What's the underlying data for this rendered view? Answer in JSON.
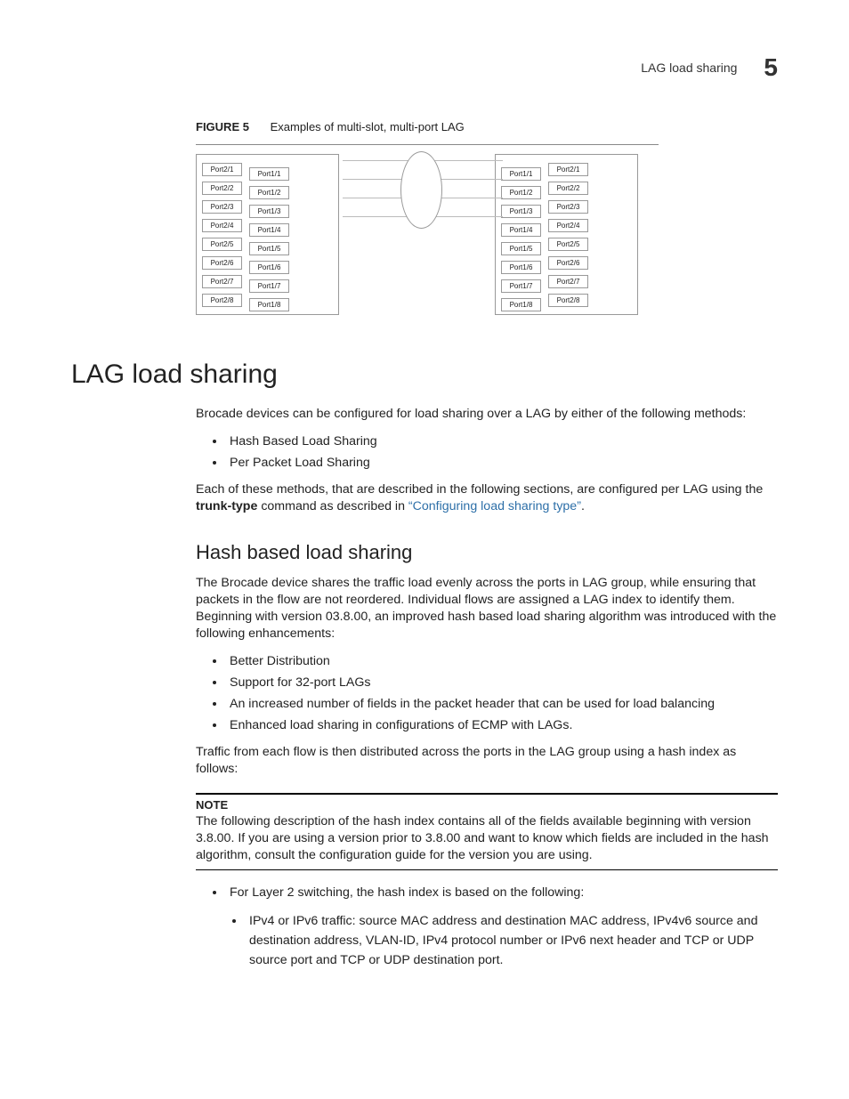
{
  "header": {
    "running_title": "LAG load sharing",
    "chapter_number": "5"
  },
  "figure": {
    "label": "FIGURE 5",
    "caption": "Examples of multi-slot, multi-port LAG",
    "left_switch_rows": [
      [
        "Port2/1",
        "Port1/1"
      ],
      [
        "Port2/2",
        "Port1/2"
      ],
      [
        "Port2/3",
        "Port1/3"
      ],
      [
        "Port2/4",
        "Port1/4"
      ],
      [
        "Port2/5",
        "Port1/5"
      ],
      [
        "Port2/6",
        "Port1/6"
      ],
      [
        "Port2/7",
        "Port1/7"
      ],
      [
        "Port2/8",
        "Port1/8"
      ]
    ],
    "right_switch_rows": [
      [
        "Port1/1",
        "Port2/1"
      ],
      [
        "Port1/2",
        "Port2/2"
      ],
      [
        "Port1/3",
        "Port2/3"
      ],
      [
        "Port1/4",
        "Port2/4"
      ],
      [
        "Port1/5",
        "Port2/5"
      ],
      [
        "Port1/6",
        "Port2/6"
      ],
      [
        "Port1/7",
        "Port2/7"
      ],
      [
        "Port1/8",
        "Port2/8"
      ]
    ]
  },
  "section": {
    "title": "LAG load sharing",
    "intro": "Brocade devices can be configured for load sharing over a LAG by either of the following methods:",
    "method_bullets": [
      "Hash Based Load Sharing",
      "Per Packet Load Sharing"
    ],
    "after_methods_pre": "Each of these methods, that are described in the following sections, are configured per LAG using the ",
    "command": "trunk-type",
    "after_methods_mid": " command as described in ",
    "xref": "“Configuring load sharing type”",
    "after_methods_post": "."
  },
  "subsection": {
    "title": "Hash based load sharing",
    "para1": "The Brocade device shares the traffic load evenly across the ports in LAG group, while ensuring that packets in the flow are not reordered. Individual flows are assigned a LAG index to identify them. Beginning with version 03.8.00, an improved hash based load sharing algorithm was introduced with the following enhancements:",
    "enh_bullets": [
      "Better Distribution",
      "Support for 32-port LAGs",
      "An increased number of fields in the packet header that can be used for load balancing",
      "Enhanced load sharing in configurations of ECMP with LAGs."
    ],
    "para2": "Traffic from each flow is then distributed across the ports in the LAG group using a hash index as follows:"
  },
  "note": {
    "label": "NOTE",
    "body": "The following description of the hash index contains all of the fields available beginning with version 3.8.00. If you are using a version prior to 3.8.00 and want to know which fields are included in the hash algorithm, consult the configuration guide for the version you are using."
  },
  "hashlist": {
    "l2_intro": "For Layer 2 switching, the hash index is based on the following:",
    "l2_sub1": "IPv4 or IPv6 traffic: source MAC address and destination MAC address, IPv4v6 source and destination address, VLAN-ID, IPv4 protocol number or IPv6 next header and TCP or UDP source port and TCP or UDP destination port."
  }
}
